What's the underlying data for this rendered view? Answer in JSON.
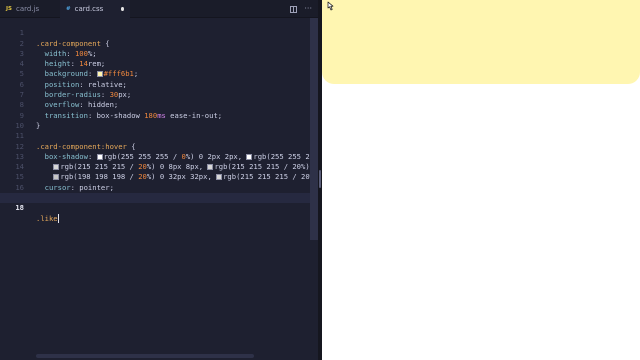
{
  "tabs": [
    {
      "badge": "JS",
      "label": "card.js",
      "active": false
    },
    {
      "badge": "",
      "label": "card.css",
      "active": true,
      "modified": true
    }
  ],
  "editor": {
    "current_line": 18,
    "lines": [
      {
        "n": "1"
      },
      {
        "n": "2"
      },
      {
        "n": "3"
      },
      {
        "n": "4"
      },
      {
        "n": "5"
      },
      {
        "n": "6"
      },
      {
        "n": "7"
      },
      {
        "n": "8"
      },
      {
        "n": "9"
      },
      {
        "n": "10"
      },
      {
        "n": "11"
      },
      {
        "n": "12"
      },
      {
        "n": "13"
      },
      {
        "n": "14"
      },
      {
        "n": "15"
      },
      {
        "n": "16"
      },
      {
        "n": "17"
      },
      {
        "n": "18"
      }
    ],
    "code": {
      "l1_sel": ".card-component",
      "l1_rest": " {",
      "l2_prop": "width",
      "l2_num": "100",
      "l2_rest": "%;",
      "l3_prop": "height",
      "l3_num": "14",
      "l3_rest": "rem;",
      "l4_prop": "background",
      "l4_val": "#fff6b1",
      "l5_prop": "position",
      "l5_val": "relative;",
      "l6_prop": "border-radius",
      "l6_num": "30",
      "l6_rest": "px;",
      "l7_prop": "overflow",
      "l7_val": "hidden;",
      "l8_prop": "transition",
      "l8_val1": "box-shadow ",
      "l8_num": "180",
      "l8_unit": "ms",
      "l8_kw": " ease-in-out",
      "l8_end": ";",
      "l9": "}",
      "l11_sel": ".card-component:hover",
      "l11_rest": " {",
      "l12_prop": "box-shadow",
      "l12_a": "rgb(255 255 255 / ",
      "l12_a_num": "0",
      "l12_a_rest": "%) 0 2px 2px, ",
      "l12_b": "rgb(255 255 255 / 0",
      "l13_a": "rgb(215 215 215 / ",
      "l13_a_num": "20",
      "l13_a_rest": "%) 0 8px 8px, ",
      "l13_b": "rgb(215 215 215 / 20%) 0 16p",
      "l14_a": "rgb(198 198 198 / ",
      "l14_a_num": "20",
      "l14_a_rest": "%) 0 32px 32px, ",
      "l14_b": "rgb(215 215 215 / 20%) 0 6",
      "l15_prop": "cursor",
      "l15_val": "pointer;",
      "l16": "}",
      "l18": ".like"
    }
  },
  "colors": {
    "swatch_card": "#fff6b1",
    "swatch_white": "#ffffff",
    "swatch_gray": "#d7d7d7",
    "swatch_dark": "#c6c6c6",
    "preview_card": "#fff6b1"
  }
}
